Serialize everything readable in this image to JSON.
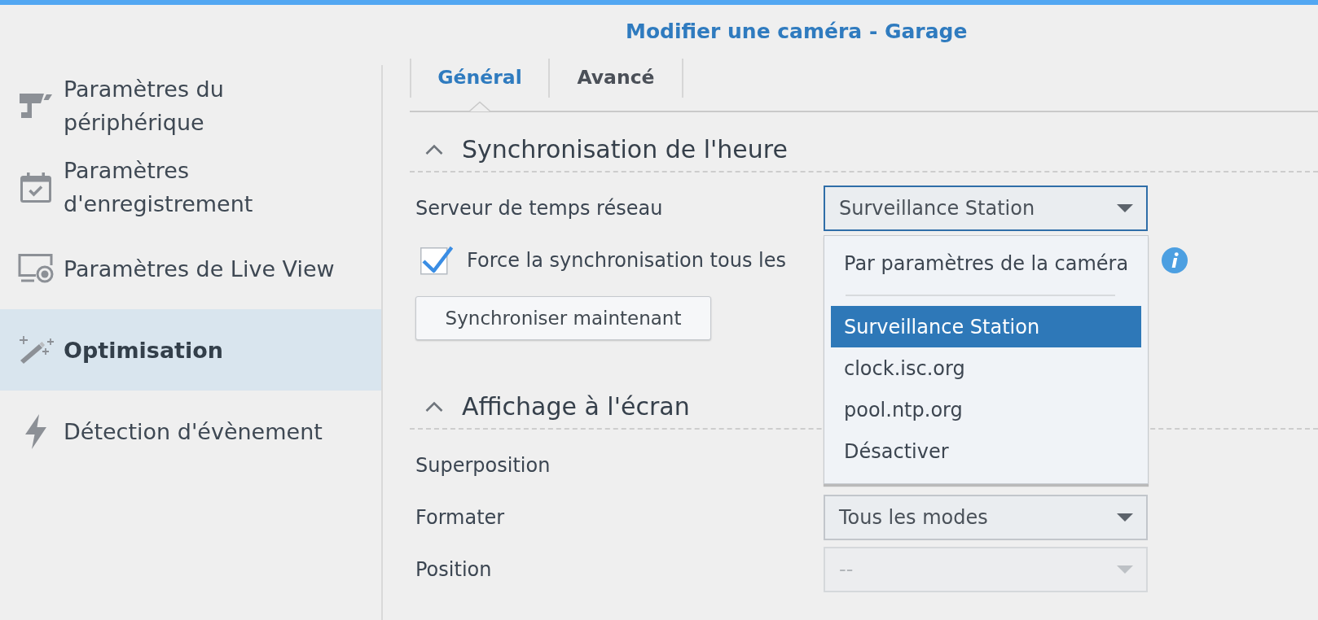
{
  "window": {
    "title": "Modifier une caméra - Garage"
  },
  "sidebar": {
    "items": [
      {
        "label": "Paramètres du périphérique",
        "selected": false
      },
      {
        "label": "Paramètres d'enregistrement",
        "selected": false
      },
      {
        "label": "Paramètres de Live View",
        "selected": false
      },
      {
        "label": "Optimisation",
        "selected": true
      },
      {
        "label": "Détection d'évènement",
        "selected": false
      }
    ]
  },
  "tabs": [
    {
      "label": "Général",
      "selected": true
    },
    {
      "label": "Avancé",
      "selected": false
    }
  ],
  "sections": [
    {
      "title": "Synchronisation de l'heure",
      "expanded": true,
      "rows": [
        {
          "kind": "select",
          "label": "Serveur de temps réseau",
          "value": "Surveillance Station",
          "disabled": false,
          "expanded": true,
          "options": [
            {
              "kind": "option",
              "label": "Par paramètres de la caméra",
              "selected": false
            },
            {
              "kind": "separator"
            },
            {
              "kind": "option",
              "label": "Surveillance Station",
              "selected": true
            },
            {
              "kind": "option",
              "label": "clock.isc.org",
              "selected": false
            },
            {
              "kind": "option",
              "label": "pool.ntp.org",
              "selected": false
            },
            {
              "kind": "option",
              "label": "Désactiver",
              "selected": false
            }
          ]
        },
        {
          "kind": "checkbox",
          "label": "Force la synchronisation tous les",
          "checked": true,
          "info": true
        },
        {
          "kind": "button",
          "label": "Synchroniser maintenant"
        }
      ]
    },
    {
      "title": "Affichage à l'écran",
      "expanded": true,
      "rows": [
        {
          "kind": "label",
          "label": "Superposition"
        },
        {
          "kind": "select",
          "label": "Formater",
          "value": "Tous les modes",
          "disabled": false,
          "expanded": false
        },
        {
          "kind": "select",
          "label": "Position",
          "value": "--",
          "disabled": true,
          "expanded": false
        }
      ]
    }
  ]
}
